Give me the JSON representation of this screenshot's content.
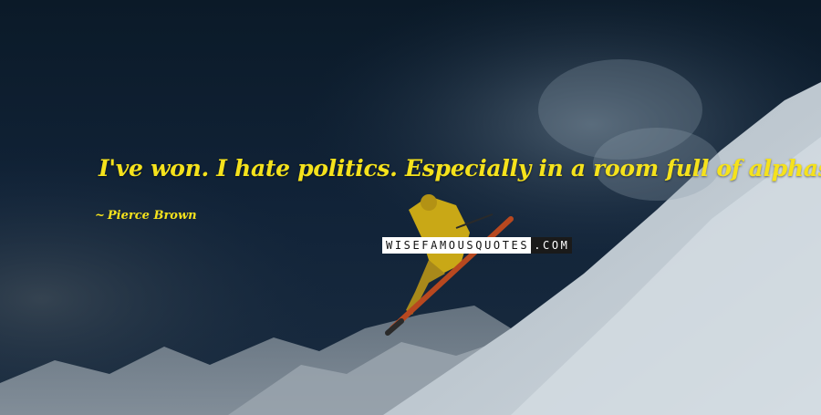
{
  "quote": {
    "text": "I've won. I hate politics. Especially in a room full of alphas.",
    "author_dash": "~",
    "author": "Pierce Brown",
    "text_color": "#f5e21c"
  },
  "watermark": {
    "part_light": "WISEFAMOUSQUOTES",
    "part_dark": ".COM"
  },
  "background": {
    "sky_color": "#0d1a26",
    "snow_color": "#c9d4dc",
    "skier_suit_color": "#d4b21a"
  }
}
